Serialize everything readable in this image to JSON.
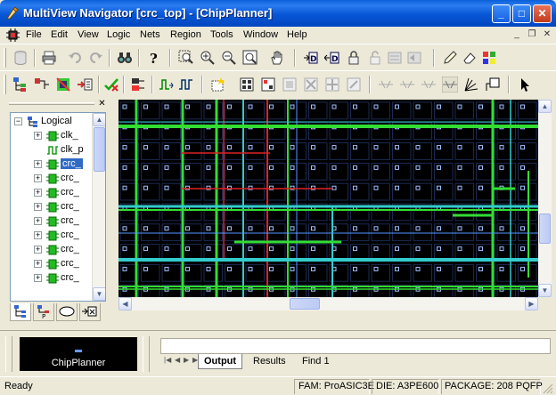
{
  "window": {
    "title": "MultiView Navigator [crc_top] - [ChipPlanner]"
  },
  "menu": [
    "File",
    "Edit",
    "View",
    "Logic",
    "Nets",
    "Region",
    "Tools",
    "Window",
    "Help"
  ],
  "tree": {
    "items": [
      {
        "label": "Logical",
        "icon": "hierarchy-icon",
        "expander": "−"
      },
      {
        "label": "clk_",
        "icon": "module-icon",
        "expander": "+"
      },
      {
        "label": "clk_p",
        "icon": "clock-net-icon",
        "expander": ""
      },
      {
        "label": "crc_",
        "icon": "module-icon",
        "expander": "+",
        "selected": true
      },
      {
        "label": "crc_",
        "icon": "module-icon",
        "expander": "+"
      },
      {
        "label": "crc_",
        "icon": "module-icon",
        "expander": "+"
      },
      {
        "label": "crc_",
        "icon": "module-icon",
        "expander": "+"
      },
      {
        "label": "crc_",
        "icon": "module-icon",
        "expander": "+"
      },
      {
        "label": "crc_",
        "icon": "module-icon",
        "expander": "+"
      },
      {
        "label": "crc_",
        "icon": "module-icon",
        "expander": "+"
      },
      {
        "label": "crc_",
        "icon": "module-icon",
        "expander": "+"
      },
      {
        "label": "crc_",
        "icon": "module-icon",
        "expander": "+"
      }
    ]
  },
  "output": {
    "thumbnail_label": "ChipPlanner",
    "tabs": [
      "Output",
      "Results",
      "Find 1"
    ],
    "active_tab": "Output"
  },
  "status": {
    "text": "Ready",
    "fam": "FAM: ProASIC3E",
    "die": "DIE: A3PE600",
    "package": "PACKAGE: 208 PQFP"
  },
  "colors": {
    "titlebar": "#0a5fd8",
    "chip_bg": "#000000",
    "net_green": "#33dd33",
    "net_red": "#dd2222",
    "net_cyan": "#33cccc",
    "grid_blue": "#5599ff",
    "selection": "#316ac5"
  }
}
